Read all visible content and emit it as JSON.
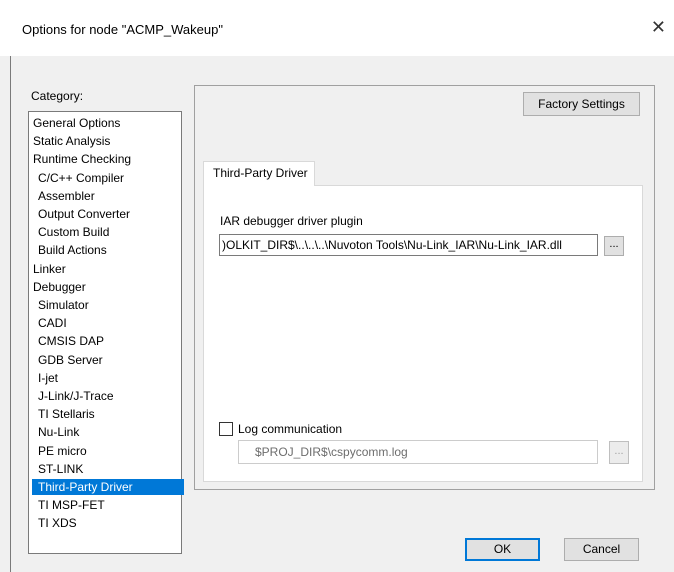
{
  "window": {
    "title": "Options for node \"ACMP_Wakeup\"",
    "close_glyph": "✕"
  },
  "category": {
    "label": "Category:",
    "items": [
      {
        "label": "General Options",
        "level": 0
      },
      {
        "label": "Static Analysis",
        "level": 0
      },
      {
        "label": "Runtime Checking",
        "level": 0
      },
      {
        "label": "C/C++ Compiler",
        "level": 1
      },
      {
        "label": "Assembler",
        "level": 1
      },
      {
        "label": "Output Converter",
        "level": 1
      },
      {
        "label": "Custom Build",
        "level": 1
      },
      {
        "label": "Build Actions",
        "level": 1
      },
      {
        "label": "Linker",
        "level": 0
      },
      {
        "label": "Debugger",
        "level": 0
      },
      {
        "label": "Simulator",
        "level": 1
      },
      {
        "label": "CADI",
        "level": 1
      },
      {
        "label": "CMSIS DAP",
        "level": 1
      },
      {
        "label": "GDB Server",
        "level": 1
      },
      {
        "label": "I-jet",
        "level": 1
      },
      {
        "label": "J-Link/J-Trace",
        "level": 1
      },
      {
        "label": "TI Stellaris",
        "level": 1
      },
      {
        "label": "Nu-Link",
        "level": 1
      },
      {
        "label": "PE micro",
        "level": 1
      },
      {
        "label": "ST-LINK",
        "level": 1
      },
      {
        "label": "Third-Party Driver",
        "level": 1,
        "selected": true
      },
      {
        "label": "TI MSP-FET",
        "level": 1
      },
      {
        "label": "TI XDS",
        "level": 1
      }
    ]
  },
  "panel": {
    "factory_settings_label": "Factory Settings",
    "tab_label": "Third-Party Driver",
    "driver_plugin_label": "IAR debugger driver plugin",
    "driver_plugin_value": ")OLKIT_DIR$\\..\\..\\..\\Nuvoton Tools\\Nu-Link_IAR\\Nu-Link_IAR.dll",
    "browse_label": "...",
    "log_checkbox_label": "Log communication",
    "log_checked": false,
    "log_file_value": "$PROJ_DIR$\\cspycomm.log"
  },
  "buttons": {
    "ok": "OK",
    "cancel": "Cancel"
  },
  "colors": {
    "selection": "#0078d7",
    "dialog_bg": "#f0f0f0"
  }
}
